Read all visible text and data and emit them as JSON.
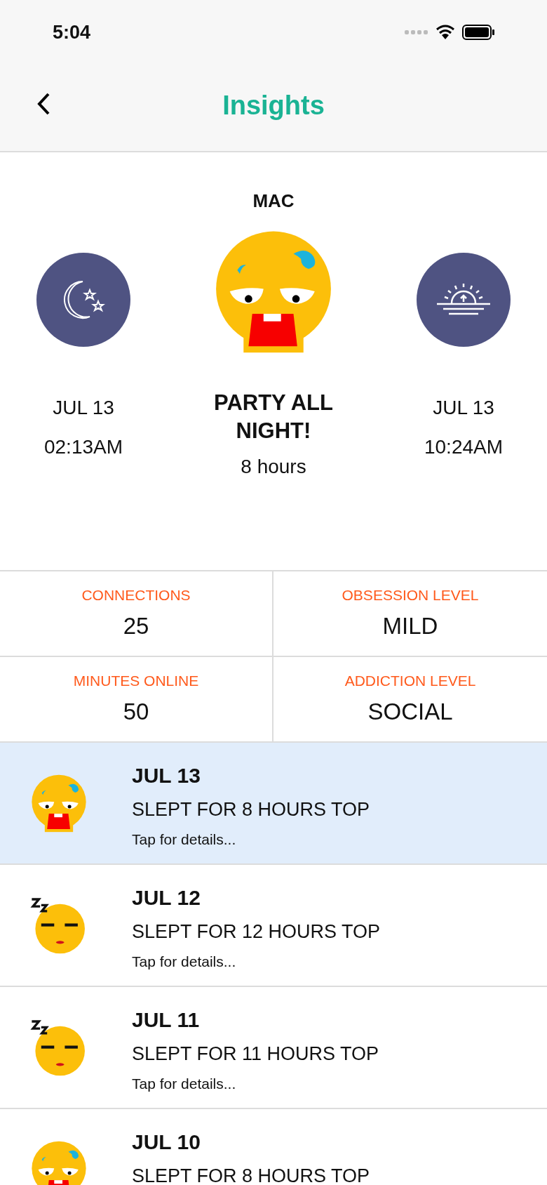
{
  "status_bar": {
    "time": "5:04"
  },
  "header": {
    "title": "Insights"
  },
  "device": "MAC",
  "summary": {
    "start": {
      "date": "JUL 13",
      "time": "02:13AM"
    },
    "mood": {
      "kind": "party",
      "title": "PARTY ALL NIGHT!",
      "duration": "8 hours"
    },
    "end": {
      "date": "JUL 13",
      "time": "10:24AM"
    }
  },
  "stats": [
    {
      "label": "CONNECTIONS",
      "value": "25"
    },
    {
      "label": "OBSESSION LEVEL",
      "value": "MILD"
    },
    {
      "label": "MINUTES ONLINE",
      "value": "50"
    },
    {
      "label": "ADDICTION LEVEL",
      "value": "SOCIAL"
    }
  ],
  "days": [
    {
      "date": "JUL 13",
      "summary": "SLEPT FOR 8 HOURS TOP",
      "hint": "Tap for details...",
      "kind": "party",
      "selected": true
    },
    {
      "date": "JUL 12",
      "summary": "SLEPT FOR 12 HOURS TOP",
      "hint": "Tap for details...",
      "kind": "sleepy",
      "selected": false
    },
    {
      "date": "JUL 11",
      "summary": "SLEPT FOR 11 HOURS TOP",
      "hint": "Tap for details...",
      "kind": "sleepy",
      "selected": false
    },
    {
      "date": "JUL 10",
      "summary": "SLEPT FOR 8 HOURS TOP",
      "kind": "party",
      "selected": false
    }
  ]
}
